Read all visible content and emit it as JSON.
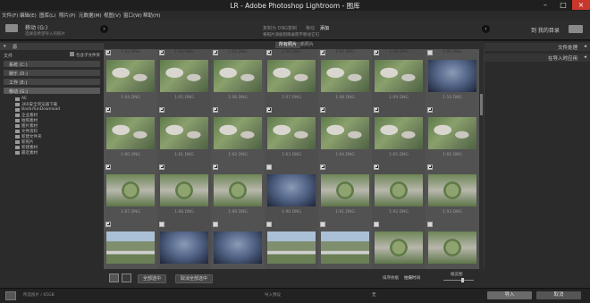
{
  "window": {
    "title": "LR - Adobe Photoshop Lightroom - 图库"
  },
  "menubar": [
    "文件(F)",
    "编辑(E)",
    "图库(L)",
    "照片(P)",
    "元数据(M)",
    "视图(V)",
    "窗口(W)",
    "帮助(H)"
  ],
  "header": {
    "source_label": "移动 (G:)",
    "source_sub": "选择您希望导入的照片",
    "modes": [
      "复制为 DNG",
      "复制",
      "移动",
      "添加"
    ],
    "active_mode": "添加",
    "mode_desc": "将照片添加到目录而不移动它们",
    "dest_label": "到 我的目录"
  },
  "left_panel": {
    "header": "源",
    "sub_label": "文件",
    "include_subfolders": "包含子文件夹",
    "sources": [
      {
        "label": "系统 (C:)"
      },
      {
        "label": "娱乐 (D:)"
      },
      {
        "label": "工作 (E:)"
      },
      {
        "label": "移动 (G:)"
      }
    ],
    "folders": [
      "AE",
      "360安全浏览器下载",
      "BaiduYunDownload",
      "企业素材",
      "拍照素材",
      "图片素材",
      "文件资料",
      "新建文件夹",
      "新照片",
      "新建素材",
      "最近素材"
    ]
  },
  "center": {
    "tabs": [
      "所有照片",
      "新照片"
    ],
    "active_tab": "所有照片",
    "rows": [
      {
        "nums": [
          "1:03.DNG",
          "1:04.DNG",
          "1:05.DNG",
          "1:06.DNG",
          "1:07.DNG",
          "1:08.DNG",
          "1:09.DNG"
        ],
        "files": [
          "1:04.DNG",
          "1:05.DNG",
          "1:06.DNG",
          "1:07.DNG",
          "1:08.DNG",
          "1:09.DNG",
          "1:10.DNG"
        ],
        "types": [
          "aerial",
          "aerial",
          "aerial",
          "aerial",
          "aerial",
          "aerial",
          "sky"
        ],
        "checked": [
          true,
          true,
          true,
          true,
          true,
          true,
          false
        ]
      },
      {
        "nums": [
          "",
          "",
          "",
          "",
          "",
          "",
          ""
        ],
        "files": [
          "1:60.DNG",
          "1:61.DNG",
          "1:62.DNG",
          "1:63.DNG",
          "1:64.DNG",
          "1:65.DNG",
          "1:66.DNG"
        ],
        "types": [
          "aerial",
          "aerial",
          "aerial",
          "aerial",
          "aerial",
          "aerial",
          "aerial"
        ],
        "checked": [
          true,
          true,
          true,
          true,
          true,
          true,
          true
        ]
      },
      {
        "nums": [
          "",
          "",
          "",
          "",
          "",
          "",
          ""
        ],
        "files": [
          "1:87.DNG",
          "1:88.DNG",
          "1:89.DNG",
          "1:90.DNG",
          "1:91.DNG",
          "1:92.DNG",
          "1:93.DNG"
        ],
        "types": [
          "aerial2",
          "aerial2",
          "aerial2",
          "sky",
          "aerial2",
          "aerial2",
          "aerial2"
        ],
        "checked": [
          true,
          true,
          true,
          false,
          true,
          true,
          true
        ]
      },
      {
        "nums": [
          "",
          "",
          "",
          "",
          "",
          "",
          ""
        ],
        "files": [
          "",
          "",
          "",
          "",
          "",
          "",
          ""
        ],
        "types": [
          "campus",
          "sky",
          "sky",
          "campus",
          "campus",
          "aerial2",
          "aerial2"
        ],
        "checked": [
          true,
          false,
          false,
          false,
          false,
          false,
          false
        ]
      }
    ],
    "bottom": {
      "check_all": "全部选中",
      "uncheck_all": "取消全部选中",
      "sort_label": "排序依据",
      "sort_value": "拍摄时间",
      "thumb_label": "缩览图"
    }
  },
  "right_panel": {
    "sections": [
      "文件处理",
      "在导入时应用"
    ]
  },
  "footer": {
    "status": "所选照片 / 65GB",
    "preset_label": "导入预设",
    "preset_value": "无",
    "import_button": "导入",
    "cancel_button": "取消"
  }
}
